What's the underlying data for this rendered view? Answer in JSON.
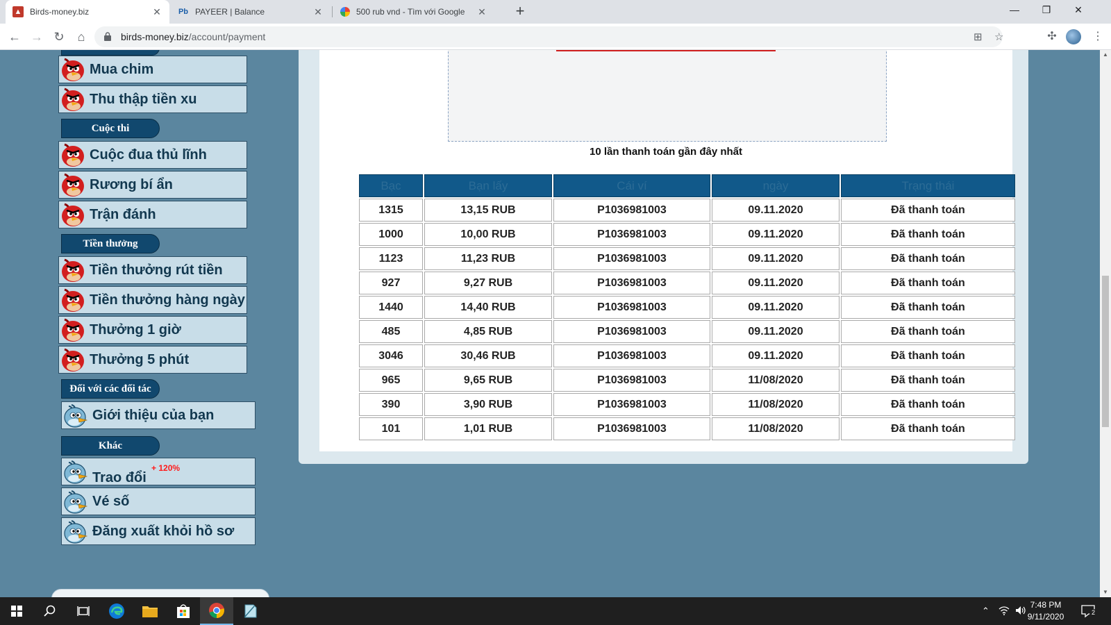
{
  "browser": {
    "tabs": [
      {
        "title": "Birds-money.biz",
        "favicon": "birds-favicon",
        "active": true
      },
      {
        "title": "PAYEER | Balance",
        "favicon": "Pb",
        "active": false
      },
      {
        "title": "500 rub vnd - Tìm với Google",
        "favicon": "google-favicon",
        "active": false
      }
    ],
    "new_tab": "+",
    "url_host": "birds-money.biz",
    "url_path": "/account/payment"
  },
  "sidebar": {
    "items_top": [
      {
        "label": "Mua chim",
        "icon": "red-bird-icon"
      },
      {
        "label": "Thu thập tiền xu",
        "icon": "red-bird-icon"
      }
    ],
    "section_contest": "Cuộc thi",
    "items_contest": [
      {
        "label": "Cuộc đua thủ lĩnh",
        "icon": "red-bird-icon"
      },
      {
        "label": "Rương bí ẩn",
        "icon": "red-bird-icon"
      },
      {
        "label": "Trận đánh",
        "icon": "red-bird-icon"
      }
    ],
    "section_bonus": "Tiền thưởng",
    "items_bonus": [
      {
        "label": "Tiền thưởng rút tiền",
        "icon": "red-bird-icon"
      },
      {
        "label": "Tiền thưởng hàng ngày",
        "icon": "red-bird-icon"
      },
      {
        "label": "Thưởng 1 giờ",
        "icon": "red-bird-icon"
      },
      {
        "label": "Thưởng 5 phút",
        "icon": "red-bird-icon"
      }
    ],
    "section_partners": "Đối với các đối tác",
    "items_partners": [
      {
        "label": "Giới thiệu của bạn",
        "icon": "blue-bird-icon"
      }
    ],
    "section_other": "Khác",
    "items_other": [
      {
        "label": "Trao đổi",
        "icon": "blue-bird-icon",
        "badge": "+ 120%"
      },
      {
        "label": "Vé số",
        "icon": "blue-bird-icon"
      },
      {
        "label": "Đăng xuất khỏi hồ sơ",
        "icon": "blue-bird-icon"
      }
    ]
  },
  "main": {
    "caption": "10 lần thanh toán gần đây nhất",
    "columns": [
      "Bạc",
      "Bạn lấy",
      "Cái ví",
      "ngày",
      "Trạng thái"
    ],
    "rows": [
      [
        "1315",
        "13,15 RUB",
        "P1036981003",
        "09.11.2020",
        "Đã thanh toán"
      ],
      [
        "1000",
        "10,00 RUB",
        "P1036981003",
        "09.11.2020",
        "Đã thanh toán"
      ],
      [
        "1123",
        "11,23 RUB",
        "P1036981003",
        "09.11.2020",
        "Đã thanh toán"
      ],
      [
        "927",
        "9,27 RUB",
        "P1036981003",
        "09.11.2020",
        "Đã thanh toán"
      ],
      [
        "1440",
        "14,40 RUB",
        "P1036981003",
        "09.11.2020",
        "Đã thanh toán"
      ],
      [
        "485",
        "4,85 RUB",
        "P1036981003",
        "09.11.2020",
        "Đã thanh toán"
      ],
      [
        "3046",
        "30,46 RUB",
        "P1036981003",
        "09.11.2020",
        "Đã thanh toán"
      ],
      [
        "965",
        "9,65 RUB",
        "P1036981003",
        "11/08/2020",
        "Đã thanh toán"
      ],
      [
        "390",
        "3,90 RUB",
        "P1036981003",
        "11/08/2020",
        "Đã thanh toán"
      ],
      [
        "101",
        "1,01 RUB",
        "P1036981003",
        "11/08/2020",
        "Đã thanh toán"
      ]
    ]
  },
  "taskbar": {
    "clock_time": "7:48 PM",
    "clock_date": "9/11/2020",
    "notification_count": "2"
  }
}
